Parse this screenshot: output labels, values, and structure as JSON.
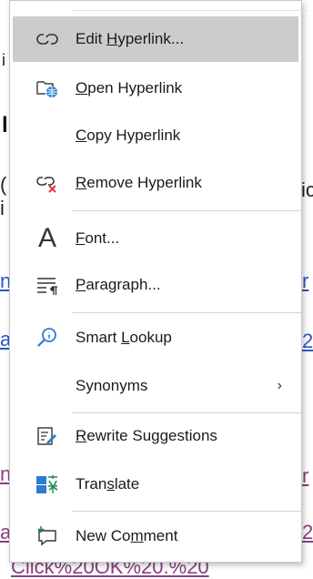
{
  "background": {
    "frag_top": "i",
    "frag_heading": "l",
    "frag_c": "(",
    "frag_i": "i",
    "frag_right_ic": "ic",
    "frag_left_link1": "n",
    "frag_left_link2": "a",
    "frag_right_r1": "r",
    "frag_right_2a": "2",
    "frag_left_link3": "n",
    "frag_left_link4": "a",
    "frag_right_r2": "r",
    "frag_right_2b": "2",
    "frag_bottom": "Click%20OK%20.%20"
  },
  "menu": {
    "items": [
      {
        "pre": "Edit ",
        "u": "H",
        "post": "yperlink...",
        "icon": "link-icon"
      },
      {
        "pre": "",
        "u": "O",
        "post": "pen Hyperlink",
        "icon": "open-hyperlink-icon"
      },
      {
        "pre": "",
        "u": "C",
        "post": "opy Hyperlink",
        "icon": ""
      },
      {
        "pre": "",
        "u": "R",
        "post": "emove Hyperlink",
        "icon": "remove-hyperlink-icon"
      },
      {
        "pre": "",
        "u": "F",
        "post": "ont...",
        "icon": "font-icon"
      },
      {
        "pre": "",
        "u": "P",
        "post": "aragraph...",
        "icon": "paragraph-icon"
      },
      {
        "pre": "Smart ",
        "u": "L",
        "post": "ookup",
        "icon": "smart-lookup-icon"
      },
      {
        "pre": "Synonyms",
        "u": "",
        "post": "",
        "icon": "",
        "submenu": "›"
      },
      {
        "pre": "",
        "u": "R",
        "post": "ewrite Suggestions",
        "icon": "rewrite-icon"
      },
      {
        "pre": "Tran",
        "u": "s",
        "post": "late",
        "icon": "translate-icon"
      },
      {
        "pre": "New Co",
        "u": "m",
        "post": "ment",
        "icon": "new-comment-icon"
      }
    ]
  }
}
